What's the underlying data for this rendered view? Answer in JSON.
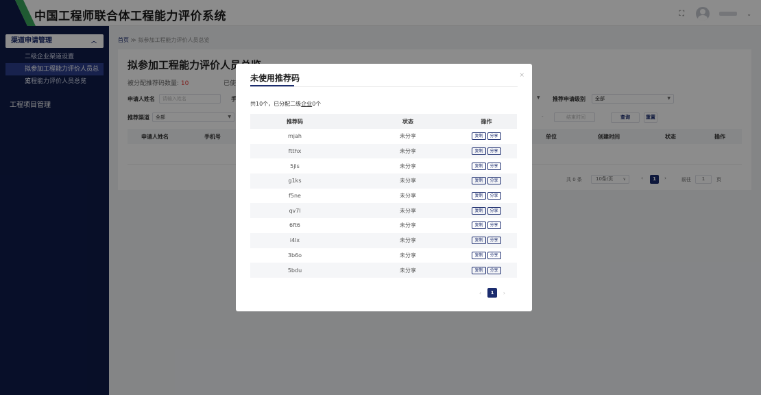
{
  "app": {
    "title": "中国工程师联合体工程能力评价系统"
  },
  "header": {
    "user_chevron": "⌄"
  },
  "sidebar": {
    "group1": "渠道申请管理",
    "items": [
      "二级企业渠道设置",
      "拟参加工程能力评价人员总览",
      "工程能力评价人员总览"
    ],
    "group2": "工程项目管理"
  },
  "breadcrumb": {
    "home": "首页",
    "sep": " ≫ ",
    "current": "拟参加工程能力评价人员总览"
  },
  "main": {
    "page_title": "拟参加工程能力评价人员总览",
    "stat_label": "被分配推荐码数量:",
    "stat_value": "10",
    "stat2_label": "已使",
    "filters": {
      "applicant_label": "申请人姓名",
      "applicant_placeholder": "请输入姓名",
      "phone_label": "手",
      "channel_label": "推荐渠道",
      "channel_value": "全部",
      "level_label": "推荐申请级别",
      "level_value": "全部",
      "end_time_placeholder": "结束时间",
      "query_btn": "查询",
      "reset_btn": "重置"
    },
    "table_headers": [
      "申请人姓名",
      "手机号",
      "单位",
      "创建时间",
      "状态",
      "操作"
    ],
    "pagination": {
      "total": "共 0 条",
      "page_size": "10条/页",
      "current": "1",
      "goto_label": "前往",
      "goto_value": "1",
      "page_unit": "页"
    }
  },
  "modal": {
    "title": "未使用推荐码",
    "close": "×",
    "summary_prefix": "共10个，已分配二级",
    "summary_link": "企业",
    "summary_suffix": "0个",
    "columns": [
      "推荐码",
      "状态",
      "操作"
    ],
    "rows": [
      {
        "code": "mjah",
        "status": "未分享"
      },
      {
        "code": "ftthx",
        "status": "未分享"
      },
      {
        "code": "5jls",
        "status": "未分享"
      },
      {
        "code": "g1ks",
        "status": "未分享"
      },
      {
        "code": "f5ne",
        "status": "未分享"
      },
      {
        "code": "qv7l",
        "status": "未分享"
      },
      {
        "code": "6ft6",
        "status": "未分享"
      },
      {
        "code": "i4lx",
        "status": "未分享"
      },
      {
        "code": "3b6o",
        "status": "未分享"
      },
      {
        "code": "5bdu",
        "status": "未分享"
      }
    ],
    "copy_label": "复制",
    "share_label": "分享",
    "pager": {
      "prev": "‹",
      "current": "1",
      "next": "›"
    }
  },
  "colors": {
    "primary": "#1b2c6e",
    "sidebar_bg": "#0f1c4a",
    "accent_green": "#3aa55c",
    "danger": "#e53935"
  },
  "icons": {
    "fullscreen": "fullscreen-icon",
    "avatar": "user-avatar-icon"
  }
}
